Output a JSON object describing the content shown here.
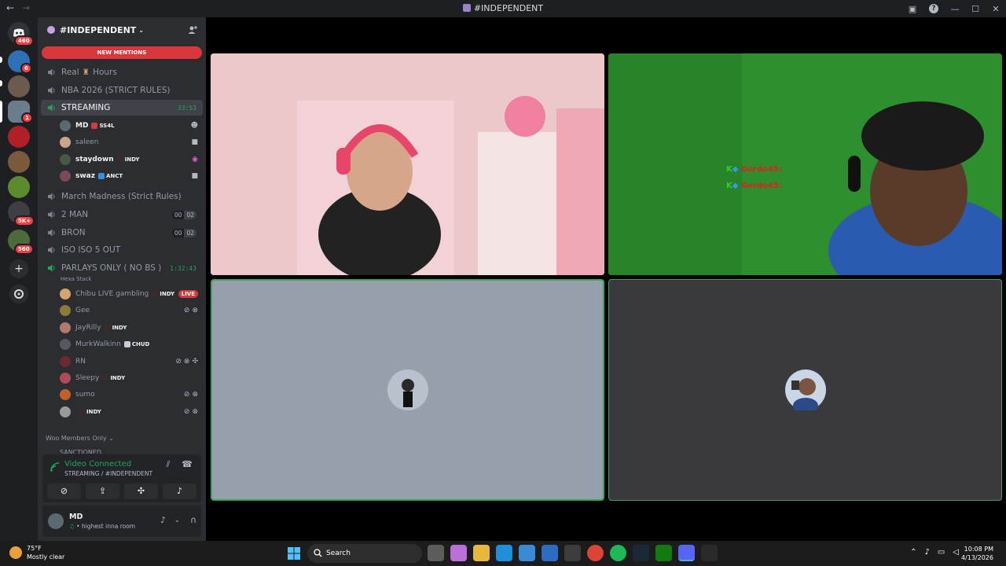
{
  "window": {
    "title": "#INDEPENDENT"
  },
  "rail": {
    "home_badge": "460",
    "badges": {
      "s2": "6",
      "s4": "1",
      "s8": "5K+",
      "s9": "560"
    }
  },
  "guild": {
    "name": "#INDEPENDENT",
    "new_mentions": "NEW MENTIONS"
  },
  "channels": {
    "real_hours_a": "Real",
    "real_hours_b": "Hours",
    "nba": "NBA 2026 (STRICT RULES)",
    "streaming": {
      "name": "STREAMING",
      "timer": "33:53"
    },
    "march": "March Madness (Strict Rules)",
    "two_man": {
      "name": "2 MAN",
      "count_a": "00",
      "count_b": "02"
    },
    "bron": {
      "name": "BRON",
      "count_a": "00",
      "count_b": "02"
    },
    "iso": "ISO ISO 5 OUT",
    "parlays": {
      "name": "PARLAYS ONLY ( NO BS )",
      "timer": "1:32:43",
      "sub": "Hexa Stack"
    }
  },
  "streaming_users": [
    {
      "name": "MD",
      "tag": "SS4L"
    },
    {
      "name": "saleen",
      "tag": ""
    },
    {
      "name": "staydown",
      "tag": "INDY"
    },
    {
      "name": "swaz",
      "tag": "ANCT"
    }
  ],
  "parlays_users": [
    {
      "name": "Chibu LIVE gambling",
      "tag": "INDY",
      "live": "LIVE"
    },
    {
      "name": "Gee",
      "tag": ""
    },
    {
      "name": "JayRilly",
      "tag": "INDY"
    },
    {
      "name": "MurkWalkinn",
      "tag": "CHUD"
    },
    {
      "name": "RN",
      "tag": ""
    },
    {
      "name": "Sleepy",
      "tag": "INDY"
    },
    {
      "name": "sumo",
      "tag": ""
    },
    {
      "name": "",
      "tag": "INDY"
    }
  ],
  "categories": {
    "woo": "Woo Members Only",
    "sanctioned": "SANCTIONED"
  },
  "voice": {
    "status": "Video Connected",
    "location": "STREAMING / #INDEPENDENT"
  },
  "me": {
    "name": "MD",
    "status": "highest inna room"
  },
  "overlay": {
    "line1": "Gordo45:",
    "line2": "Gordo45:"
  },
  "taskbar": {
    "temp": "75°F",
    "weather": "Mostly clear",
    "search": "Search",
    "time": "10:08 PM",
    "date": "4/13/2026"
  }
}
